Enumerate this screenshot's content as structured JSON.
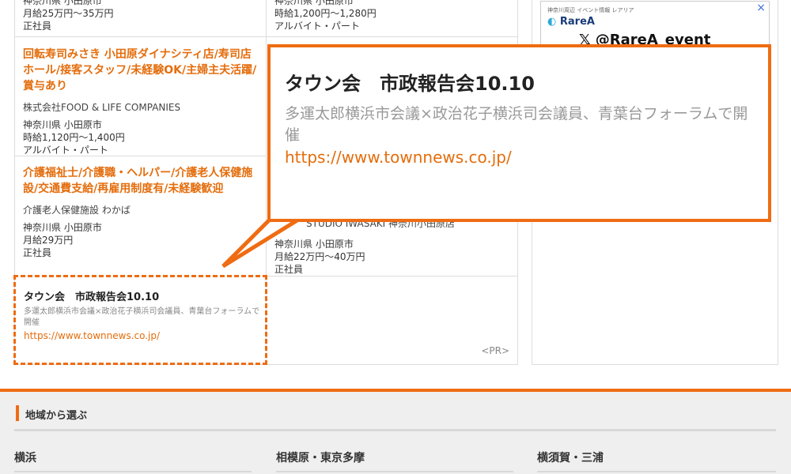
{
  "left_jobs": {
    "top_partial": {
      "location": "神奈川県 小田原市",
      "salary": "月給25万円〜35万円",
      "type": "正社員"
    },
    "job1": {
      "title": "回転寿司みさき 小田原ダイナシティ店/寿司店ホール/接客スタッフ/未経験OK/主婦主夫活躍/賞与あり",
      "company": "株式会社FOOD & LIFE COMPANIES",
      "location": "神奈川県 小田原市",
      "salary": "時給1,120円〜1,400円",
      "type": "アルバイト・パート"
    },
    "job2": {
      "title": "介護福祉士/介護職・ヘルパー/介護老人保健施設/交通費支給/再雇用制度有/未経験歓迎",
      "company": "介護老人保健施設 わかば",
      "location": "神奈川県 小田原市",
      "salary": "月給29万円",
      "type": "正社員"
    }
  },
  "middle_jobs": {
    "top_partial": {
      "location": "神奈川県 小田原市",
      "salary": "時給1,200円〜1,280円",
      "type": "アルバイト・パート"
    },
    "bottom_partial": {
      "company": "STUDIO IWASAKI 神奈川小田原店",
      "location": "神奈川県 小田原市",
      "salary": "月給22万円〜40万円",
      "type": "正社員"
    },
    "pr_label": "<PR>"
  },
  "ad": {
    "header": "神奈川周辺 イベント情報 レアリア",
    "brand": "RareA",
    "handle": "@RareA_event",
    "close": "×"
  },
  "news": {
    "title": "タウン会　市政報告会10.10",
    "description": "多運太郎横浜市会議×政治花子横浜司会議員、青葉台フォーラムで開催",
    "url": "https://www.townnews.co.jp/"
  },
  "region": {
    "heading": "地域から選ぶ",
    "areas": [
      "横浜",
      "相模原・東京多摩",
      "横須賀・三浦"
    ]
  },
  "colors": {
    "accent": "#ef6c12",
    "link": "#e46d0c"
  }
}
